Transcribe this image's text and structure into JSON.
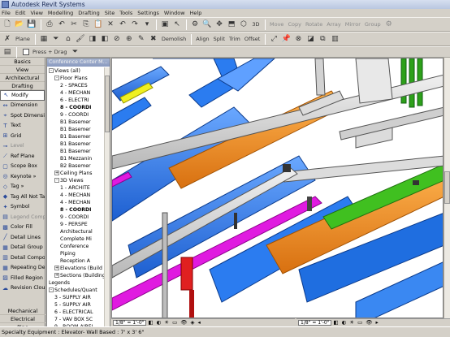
{
  "window": {
    "title": "Autodesk Revit Systems"
  },
  "menu": [
    "File",
    "Edit",
    "View",
    "Modelling",
    "Drafting",
    "Site",
    "Tools",
    "Settings",
    "Window",
    "Help"
  ],
  "toolbar2": {
    "plane": "Plane",
    "demolish": "Demolish",
    "align": "Align",
    "split": "Split",
    "trim": "Trim",
    "offset": "Offset",
    "move": "Move",
    "copy": "Copy",
    "rotate": "Rotate",
    "array": "Array",
    "mirror": "Mirror",
    "group": "Group"
  },
  "toolbar3": {
    "press_drag": "Press + Drag"
  },
  "design_bar": {
    "tabs": [
      "Basics",
      "View",
      "Architectural",
      "Drafting"
    ],
    "items": [
      {
        "label": "Modify",
        "icon": "cursor-icon"
      },
      {
        "label": "Dimension",
        "icon": "dimension-icon"
      },
      {
        "label": "Spot Dimension",
        "icon": "spot-dimension-icon"
      },
      {
        "label": "Text",
        "icon": "text-icon"
      },
      {
        "label": "Grid",
        "icon": "grid-icon"
      },
      {
        "label": "Level",
        "icon": "level-icon"
      },
      {
        "label": "Ref Plane",
        "icon": "ref-plane-icon"
      },
      {
        "label": "Scope Box",
        "icon": "scope-box-icon"
      },
      {
        "label": "Keynote »",
        "icon": "keynote-icon"
      },
      {
        "label": "Tag »",
        "icon": "tag-icon"
      },
      {
        "label": "Tag All Not Tag",
        "icon": "tag-all-icon"
      },
      {
        "label": "Symbol",
        "icon": "symbol-icon"
      },
      {
        "label": "Legend Compo",
        "icon": "legend-component-icon"
      },
      {
        "label": "Color Fill",
        "icon": "color-fill-icon"
      },
      {
        "label": "Detail Lines",
        "icon": "detail-lines-icon"
      },
      {
        "label": "Detail Group",
        "icon": "detail-group-icon"
      },
      {
        "label": "Detail Compone",
        "icon": "detail-component-icon"
      },
      {
        "label": "Repeating Deta",
        "icon": "repeating-detail-icon"
      },
      {
        "label": "Filled Region",
        "icon": "filled-region-icon"
      },
      {
        "label": "Revision Cloud",
        "icon": "revision-cloud-icon"
      }
    ],
    "bottom_tabs": [
      "Mechanical",
      "Electrical",
      "Pipe"
    ]
  },
  "project_browser": {
    "title": "Conference Center M...",
    "nodes": [
      {
        "text": "Views (all)",
        "level": 0,
        "toggle": "-"
      },
      {
        "text": "Floor Plans",
        "level": 1,
        "toggle": "-"
      },
      {
        "text": "2 - SPACES",
        "level": 2
      },
      {
        "text": "4 - MECHAN",
        "level": 2
      },
      {
        "text": "6 - ELECTRI",
        "level": 2
      },
      {
        "text": "8 - COORDI",
        "level": 2,
        "bold": true
      },
      {
        "text": "9 - COORDI",
        "level": 2
      },
      {
        "text": "B1 Basemer",
        "level": 2
      },
      {
        "text": "B1 Basemer",
        "level": 2
      },
      {
        "text": "B1 Basemer",
        "level": 2
      },
      {
        "text": "B1 Basemer",
        "level": 2
      },
      {
        "text": "B1 Basemer",
        "level": 2
      },
      {
        "text": "B1 Mezzanin",
        "level": 2
      },
      {
        "text": "B2 Basemer",
        "level": 2
      },
      {
        "text": "Ceiling Plans",
        "level": 1,
        "toggle": "+"
      },
      {
        "text": "3D Views",
        "level": 1,
        "toggle": "-"
      },
      {
        "text": "1 - ARCHITE",
        "level": 2
      },
      {
        "text": "4 - MECHAN",
        "level": 2
      },
      {
        "text": "4 - MECHAN",
        "level": 2
      },
      {
        "text": "8 - COORDI",
        "level": 2,
        "bold": true
      },
      {
        "text": "9 - COORDI",
        "level": 2
      },
      {
        "text": "9 - PERSPE",
        "level": 2
      },
      {
        "text": "Architectural",
        "level": 2
      },
      {
        "text": "Complete Mi",
        "level": 2
      },
      {
        "text": "Conference",
        "level": 2
      },
      {
        "text": "Piping",
        "level": 2
      },
      {
        "text": "Reception A",
        "level": 2
      },
      {
        "text": "Elevations (Build",
        "level": 1,
        "toggle": "+"
      },
      {
        "text": "Sections (Building",
        "level": 1,
        "toggle": "+"
      },
      {
        "text": "Legends",
        "level": 0
      },
      {
        "text": "Schedules/Quant",
        "level": 0,
        "toggle": "-"
      },
      {
        "text": "3 - SUPPLY AIR",
        "level": 1
      },
      {
        "text": "5 - SUPPLY AIR",
        "level": 1
      },
      {
        "text": "6 - ELECTRICAL",
        "level": 1
      },
      {
        "text": "7 - VAV BOX SC",
        "level": 1
      },
      {
        "text": "9 - ROOM AIRFL",
        "level": 1
      }
    ]
  },
  "view_bars": {
    "left_scale": "1/8\" = 1'-0\"",
    "right_scale": "1/8\" = 1'-0\""
  },
  "status": {
    "text": "Specialty Equipment : Elevator- Wall Based : 7' x 3' 6\""
  },
  "colors": {
    "duct_blue": "#2b7cf0",
    "pipe_orange": "#f0901e",
    "magenta": "#e01ae0",
    "yellow": "#f0f020",
    "green": "#40c020",
    "red": "#e02020",
    "gray_steel": "#d2d2d2"
  }
}
